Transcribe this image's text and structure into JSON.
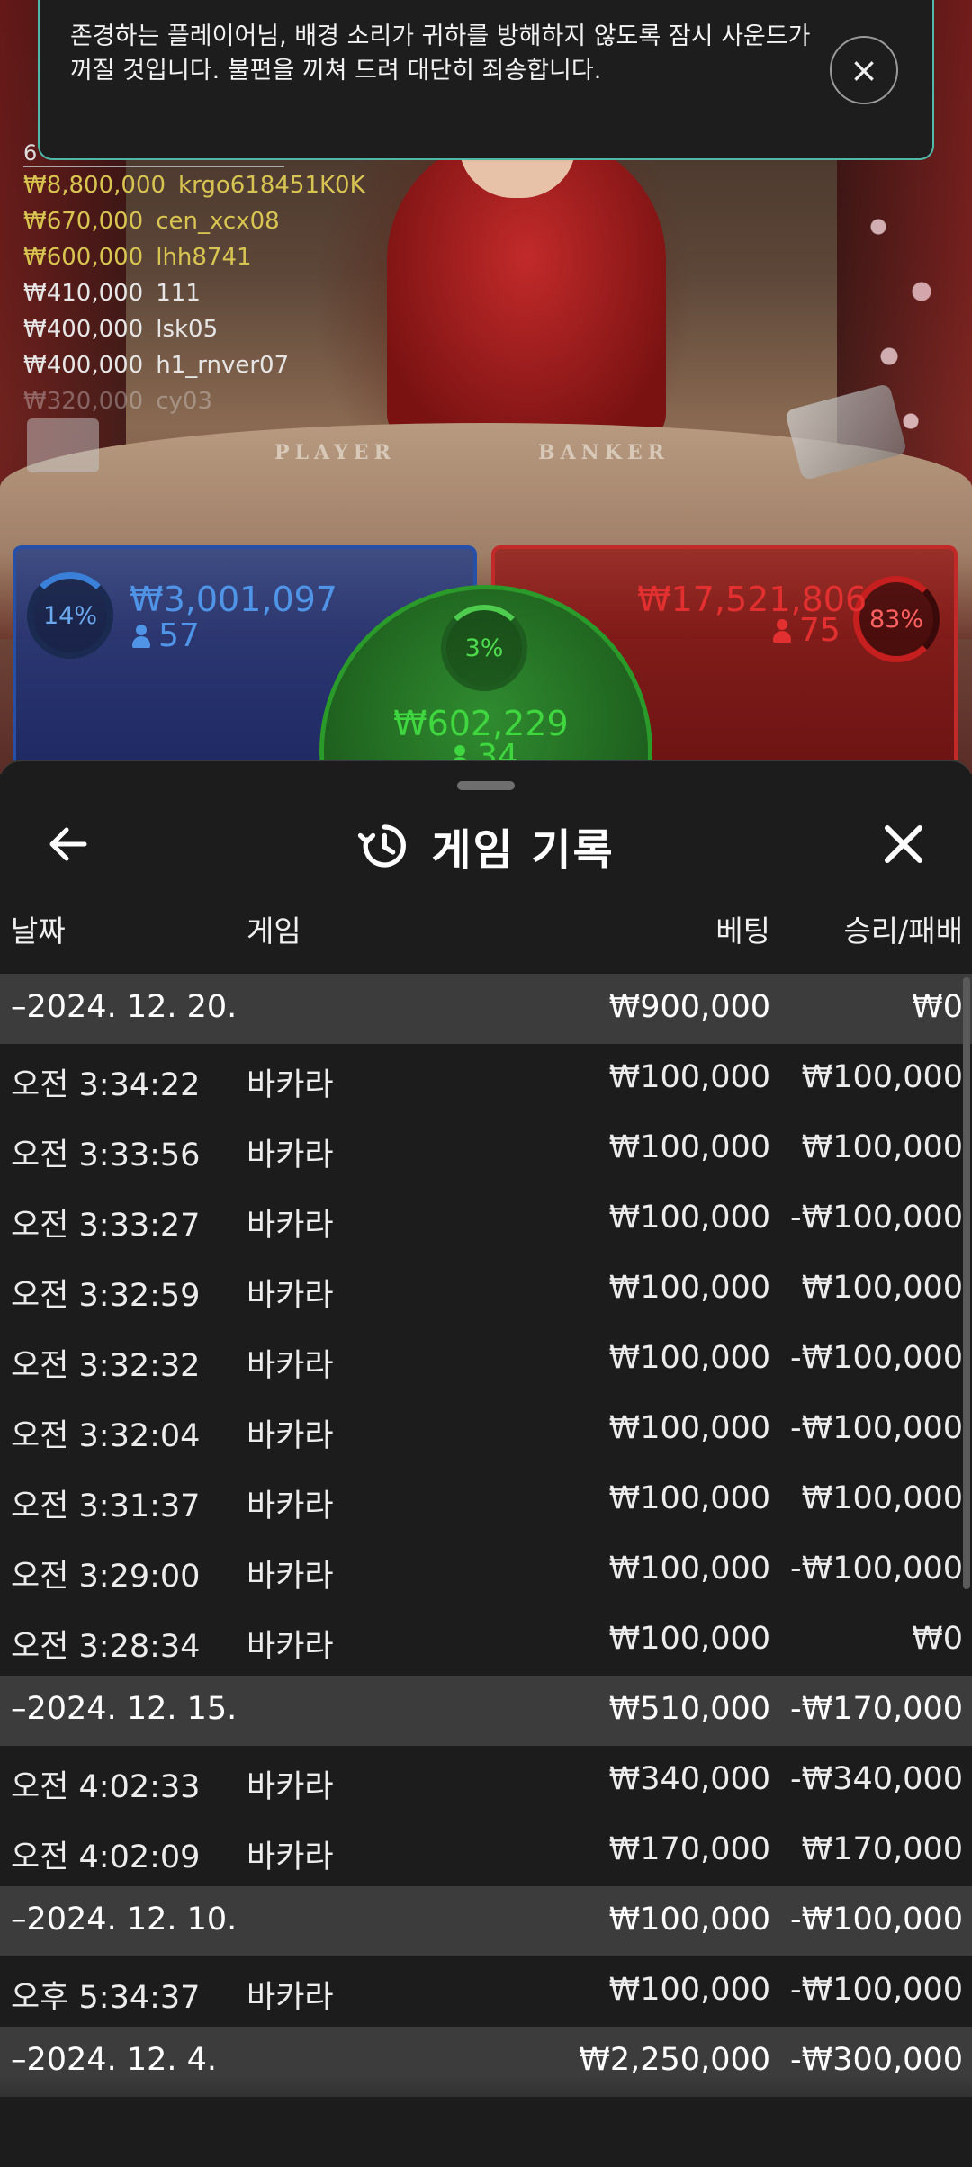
{
  "toast": {
    "message": "존경하는 플레이어님, 배경 소리가 귀하를 방해하지 않도록 잠시 사운드가 꺼질 것입니다. 불편을 끼쳐 드려 대단히 죄송합니다.",
    "close_label": "×"
  },
  "video": {
    "table_label_player": "PLAYER",
    "table_label_banker": "BANKER"
  },
  "ticker": {
    "header": "6",
    "bets": [
      {
        "amount": "₩8,800,000",
        "user": "krgo618451K0K"
      },
      {
        "amount": "₩670,000",
        "user": "cen_xcx08"
      },
      {
        "amount": "₩600,000",
        "user": "lhh8741"
      },
      {
        "amount": "₩410,000",
        "user": "111"
      },
      {
        "amount": "₩400,000",
        "user": "lsk05"
      },
      {
        "amount": "₩400,000",
        "user": "h1_rnver07"
      },
      {
        "amount": "₩320,000",
        "user": "cy03"
      }
    ]
  },
  "betting": {
    "player": {
      "percent": "14%",
      "amount": "₩3,001,097",
      "players": "57"
    },
    "banker": {
      "percent": "83%",
      "amount": "₩17,521,806",
      "players": "75"
    },
    "tie": {
      "percent": "3%",
      "amount": "₩602,229",
      "players": "34"
    }
  },
  "sheet": {
    "title": "게임 기록",
    "columns": {
      "date": "날짜",
      "game": "게임",
      "bet": "베팅",
      "result": "승리/패배"
    }
  },
  "history": [
    {
      "type": "group",
      "date": "–2024. 12. 20.",
      "bet": "₩900,000",
      "result": "₩0"
    },
    {
      "type": "row",
      "time": "오전 3:34:22",
      "game": "바카라",
      "bet": "₩100,000",
      "result": "₩100,000"
    },
    {
      "type": "row",
      "time": "오전 3:33:56",
      "game": "바카라",
      "bet": "₩100,000",
      "result": "₩100,000"
    },
    {
      "type": "row",
      "time": "오전 3:33:27",
      "game": "바카라",
      "bet": "₩100,000",
      "result": "-₩100,000"
    },
    {
      "type": "row",
      "time": "오전 3:32:59",
      "game": "바카라",
      "bet": "₩100,000",
      "result": "₩100,000"
    },
    {
      "type": "row",
      "time": "오전 3:32:32",
      "game": "바카라",
      "bet": "₩100,000",
      "result": "-₩100,000"
    },
    {
      "type": "row",
      "time": "오전 3:32:04",
      "game": "바카라",
      "bet": "₩100,000",
      "result": "-₩100,000"
    },
    {
      "type": "row",
      "time": "오전 3:31:37",
      "game": "바카라",
      "bet": "₩100,000",
      "result": "₩100,000"
    },
    {
      "type": "row",
      "time": "오전 3:29:00",
      "game": "바카라",
      "bet": "₩100,000",
      "result": "-₩100,000"
    },
    {
      "type": "row",
      "time": "오전 3:28:34",
      "game": "바카라",
      "bet": "₩100,000",
      "result": "₩0"
    },
    {
      "type": "group",
      "date": "–2024. 12. 15.",
      "bet": "₩510,000",
      "result": "-₩170,000"
    },
    {
      "type": "row",
      "time": "오전 4:02:33",
      "game": "바카라",
      "bet": "₩340,000",
      "result": "-₩340,000"
    },
    {
      "type": "row",
      "time": "오전 4:02:09",
      "game": "바카라",
      "bet": "₩170,000",
      "result": "₩170,000"
    },
    {
      "type": "group",
      "date": "–2024. 12. 10.",
      "bet": "₩100,000",
      "result": "-₩100,000"
    },
    {
      "type": "row",
      "time": "오후 5:34:37",
      "game": "바카라",
      "bet": "₩100,000",
      "result": "-₩100,000"
    },
    {
      "type": "group",
      "date": "–2024. 12. 4.",
      "bet": "₩2,250,000",
      "result": "-₩300,000"
    }
  ]
}
